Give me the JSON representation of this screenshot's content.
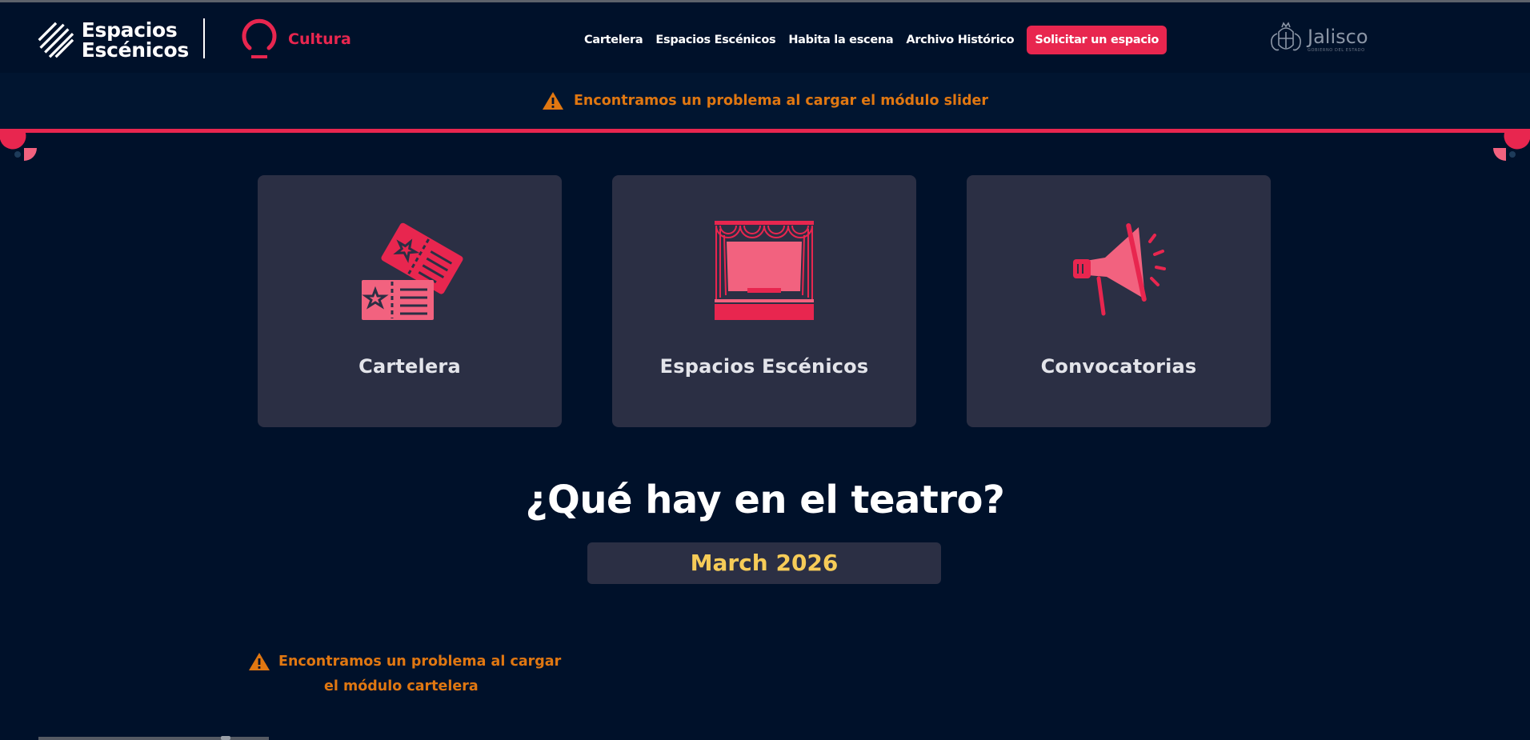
{
  "header": {
    "logo_line1": "Espacios",
    "logo_line2": "Escénicos",
    "cultura": "Cultura",
    "nav": [
      "Cartelera",
      "Espacios Escénicos",
      "Habita la escena",
      "Archivo Histórico"
    ],
    "cta": "Solicitar un espacio",
    "gov_name": "Jalisco",
    "gov_sub": "GOBIERNO DEL ESTADO"
  },
  "slider_error": "Encontramos un problema al cargar el módulo slider",
  "cards": [
    {
      "label": "Cartelera",
      "icon": "tickets-icon"
    },
    {
      "label": "Espacios Escénicos",
      "icon": "stage-icon"
    },
    {
      "label": "Convocatorias",
      "icon": "megaphone-icon"
    }
  ],
  "section_title": "¿Qué hay en el teatro?",
  "month": "March 2026",
  "cartelera_error": {
    "line1": "Encontramos un problema al cargar",
    "line2": "el módulo cartelera"
  },
  "colors": {
    "background": "#00112a",
    "accent": "#e8264f",
    "card": "#2b2f44",
    "warning": "#e07711",
    "month": "#f6cc58"
  }
}
